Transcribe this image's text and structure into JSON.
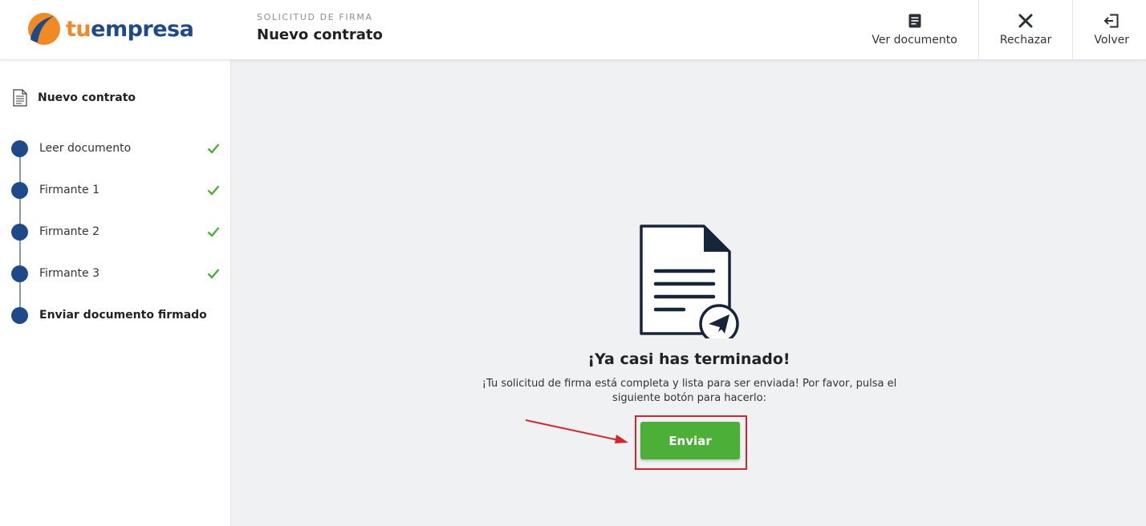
{
  "brand": {
    "prefix": "tu",
    "name": "empresa"
  },
  "header": {
    "kicker": "SOLICITUD DE FIRMA",
    "title": "Nuevo contrato",
    "actions": [
      {
        "label": "Ver documento",
        "icon": "document-icon"
      },
      {
        "label": "Rechazar",
        "icon": "close-icon"
      },
      {
        "label": "Volver",
        "icon": "exit-icon"
      }
    ]
  },
  "sidebar": {
    "document_title": "Nuevo contrato",
    "steps": [
      {
        "label": "Leer documento",
        "done": true
      },
      {
        "label": "Firmante 1",
        "done": true
      },
      {
        "label": "Firmante 2",
        "done": true
      },
      {
        "label": "Firmante 3",
        "done": true
      },
      {
        "label": "Enviar documento firmado",
        "done": false
      }
    ]
  },
  "main": {
    "heading": "¡Ya casi has terminado!",
    "description": "¡Tu solicitud de firma está completa y lista para ser enviada! Por favor, pulsa el siguiente botón para hacerlo:",
    "send_label": "Enviar"
  },
  "colors": {
    "brand_orange": "#f08a24",
    "brand_blue": "#1f4a8a",
    "success_green": "#4caf37",
    "annotation_red": "#d6262c"
  }
}
